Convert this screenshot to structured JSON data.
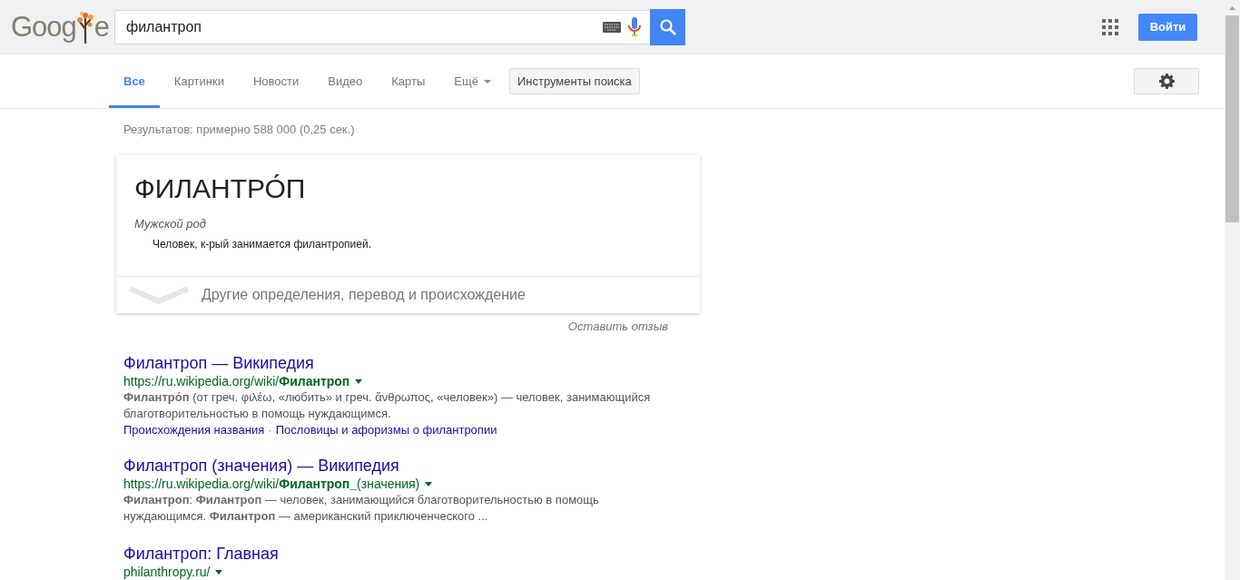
{
  "logo": {
    "left": "Goog",
    "right": "e"
  },
  "search": {
    "value": "филантроп"
  },
  "header": {
    "sign_in": "Войти"
  },
  "tabs": [
    {
      "label": "Все",
      "selected": true
    },
    {
      "label": "Картинки",
      "selected": false
    },
    {
      "label": "Новости",
      "selected": false
    },
    {
      "label": "Видео",
      "selected": false
    },
    {
      "label": "Карты",
      "selected": false
    },
    {
      "label": "Ещё",
      "selected": false,
      "kind": "dropdown"
    }
  ],
  "tools_button": "Инструменты поиска",
  "result_stats": "Результатов: примерно 588 000 (0,25 сек.)",
  "dictionary": {
    "word": "ФИЛАНТРО́П",
    "gender": "Мужской род",
    "definition": "Человек, к-рый занимается филантропией.",
    "more": "Другие определения, перевод и происхождение"
  },
  "feedback": "Оставить отзыв",
  "results": [
    {
      "title": "Филантроп — Википедия",
      "url": "https://ru.wikipedia.org/wiki/**Филантроп**",
      "snippet": "**Филантро́п** (от греч. φιλέω, «любить» и греч. ἄνθρωπος, «человек») — человек, занимающийся благотворительностью в помощь нуждающимся.",
      "sitelinks": [
        "Происхождения названия",
        "Пословицы и афоризмы о филантропии"
      ],
      "sitelink_separator": "·"
    },
    {
      "title": "Филантроп (значения) — Википедия",
      "url": "https://ru.wikipedia.org/wiki/**Филантроп_**(значения)",
      "snippet": "**Филантроп**: **Филантроп** — человек, занимающийся благотворительностью в помощь нуждающимся. **Филантроп** — американский приключенческого ..."
    },
    {
      "title": "Филантроп: Главная",
      "url": "philanthropy.ru/"
    }
  ]
}
